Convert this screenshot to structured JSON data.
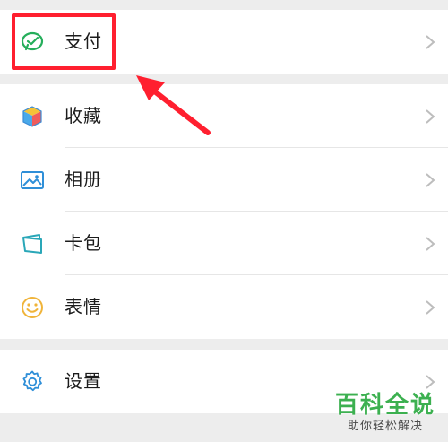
{
  "menu": {
    "payment": {
      "label": "支付",
      "icon": "wechat-pay-icon"
    },
    "favorites": {
      "label": "收藏",
      "icon": "cube-icon"
    },
    "album": {
      "label": "相册",
      "icon": "image-icon"
    },
    "cards": {
      "label": "卡包",
      "icon": "card-wallet-icon"
    },
    "stickers": {
      "label": "表情",
      "icon": "smiley-icon"
    },
    "settings": {
      "label": "设置",
      "icon": "gear-icon"
    }
  },
  "annotation": {
    "highlight_color": "#ff1f2f"
  },
  "watermark": {
    "title": "百科全说",
    "subtitle": "助你轻松解决"
  }
}
